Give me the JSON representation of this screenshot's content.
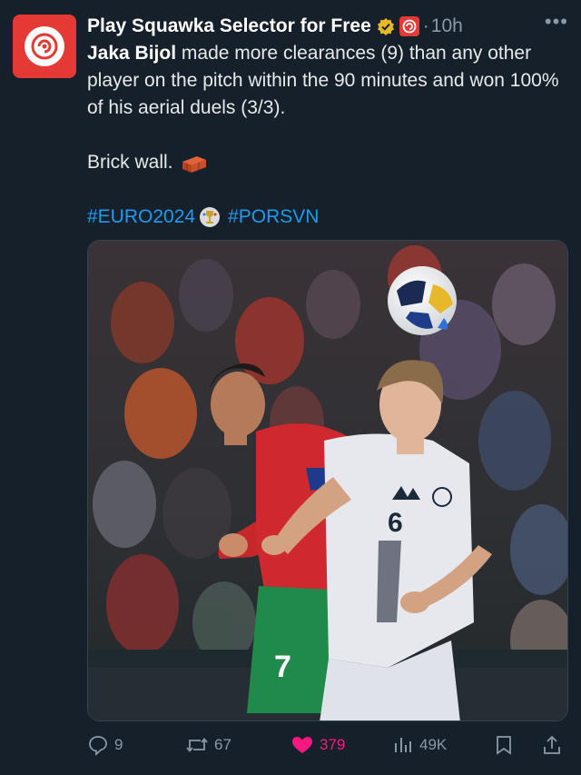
{
  "post": {
    "display_name": "Play Squawka Selector for Free",
    "separator": "·",
    "time": "10h",
    "more_label": "•••",
    "text_name": "Jaka Bijol",
    "text_rest": " made more clearances (9) than any other player on the pitch within the 90 minutes and won 100% of his aerial duels (3/3).",
    "text_second": "Brick wall.",
    "hashtag_1": "#EURO2024",
    "hashtag_2": "#PORSVN"
  },
  "media": {
    "jersey_number_red": "7",
    "jersey_number_white": "6"
  },
  "actions": {
    "replies": "9",
    "reposts": "67",
    "likes": "379",
    "views": "49K"
  },
  "icons": {
    "avatar": "squawka-logo-icon",
    "verified": "verified-badge-icon",
    "affiliate": "affiliate-badge-icon",
    "brick": "brick-emoji-icon",
    "trophy": "euro-trophy-icon",
    "reply": "reply-icon",
    "repost": "repost-icon",
    "like": "heart-icon",
    "views": "views-chart-icon",
    "bookmark": "bookmark-icon",
    "share": "share-icon"
  },
  "colors": {
    "background": "#15202b",
    "link": "#1d9bf0",
    "like": "#f91880",
    "muted": "#8b98a5",
    "brand_red": "#e53935",
    "verified_gold": "#e8b923"
  }
}
